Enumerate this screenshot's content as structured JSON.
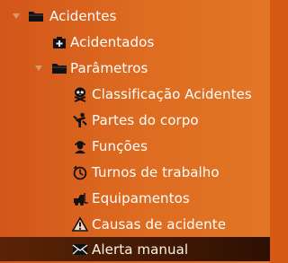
{
  "tree": {
    "root": {
      "label": "Acidentes",
      "toggle_icon": "caret-down-icon",
      "folder_icon": "folder-icon",
      "expanded": true
    },
    "acidentados": {
      "label": "Acidentados",
      "icon": "first-aid-kit-icon"
    },
    "parametros": {
      "label": "Parâmetros",
      "toggle_icon": "caret-down-icon",
      "folder_icon": "folder-icon",
      "expanded": true
    },
    "items": [
      {
        "label": "Classificação Acidentes",
        "icon": "skull-crossbones-icon"
      },
      {
        "label": "Partes do corpo",
        "icon": "injured-person-icon"
      },
      {
        "label": "Funções",
        "icon": "worker-icon"
      },
      {
        "label": "Turnos de trabalho",
        "icon": "clock-icon"
      },
      {
        "label": "Equipamentos",
        "icon": "forklift-icon"
      },
      {
        "label": "Causas de acidente",
        "icon": "warning-triangle-icon"
      },
      {
        "label": "Alerta manual",
        "icon": "envelope-icon",
        "selected": true
      }
    ]
  },
  "colors": {
    "panel_background": "#dc661f",
    "selected_background": "#461a04",
    "text": "#ffffff",
    "toggle_arrow": "#d79a71"
  }
}
